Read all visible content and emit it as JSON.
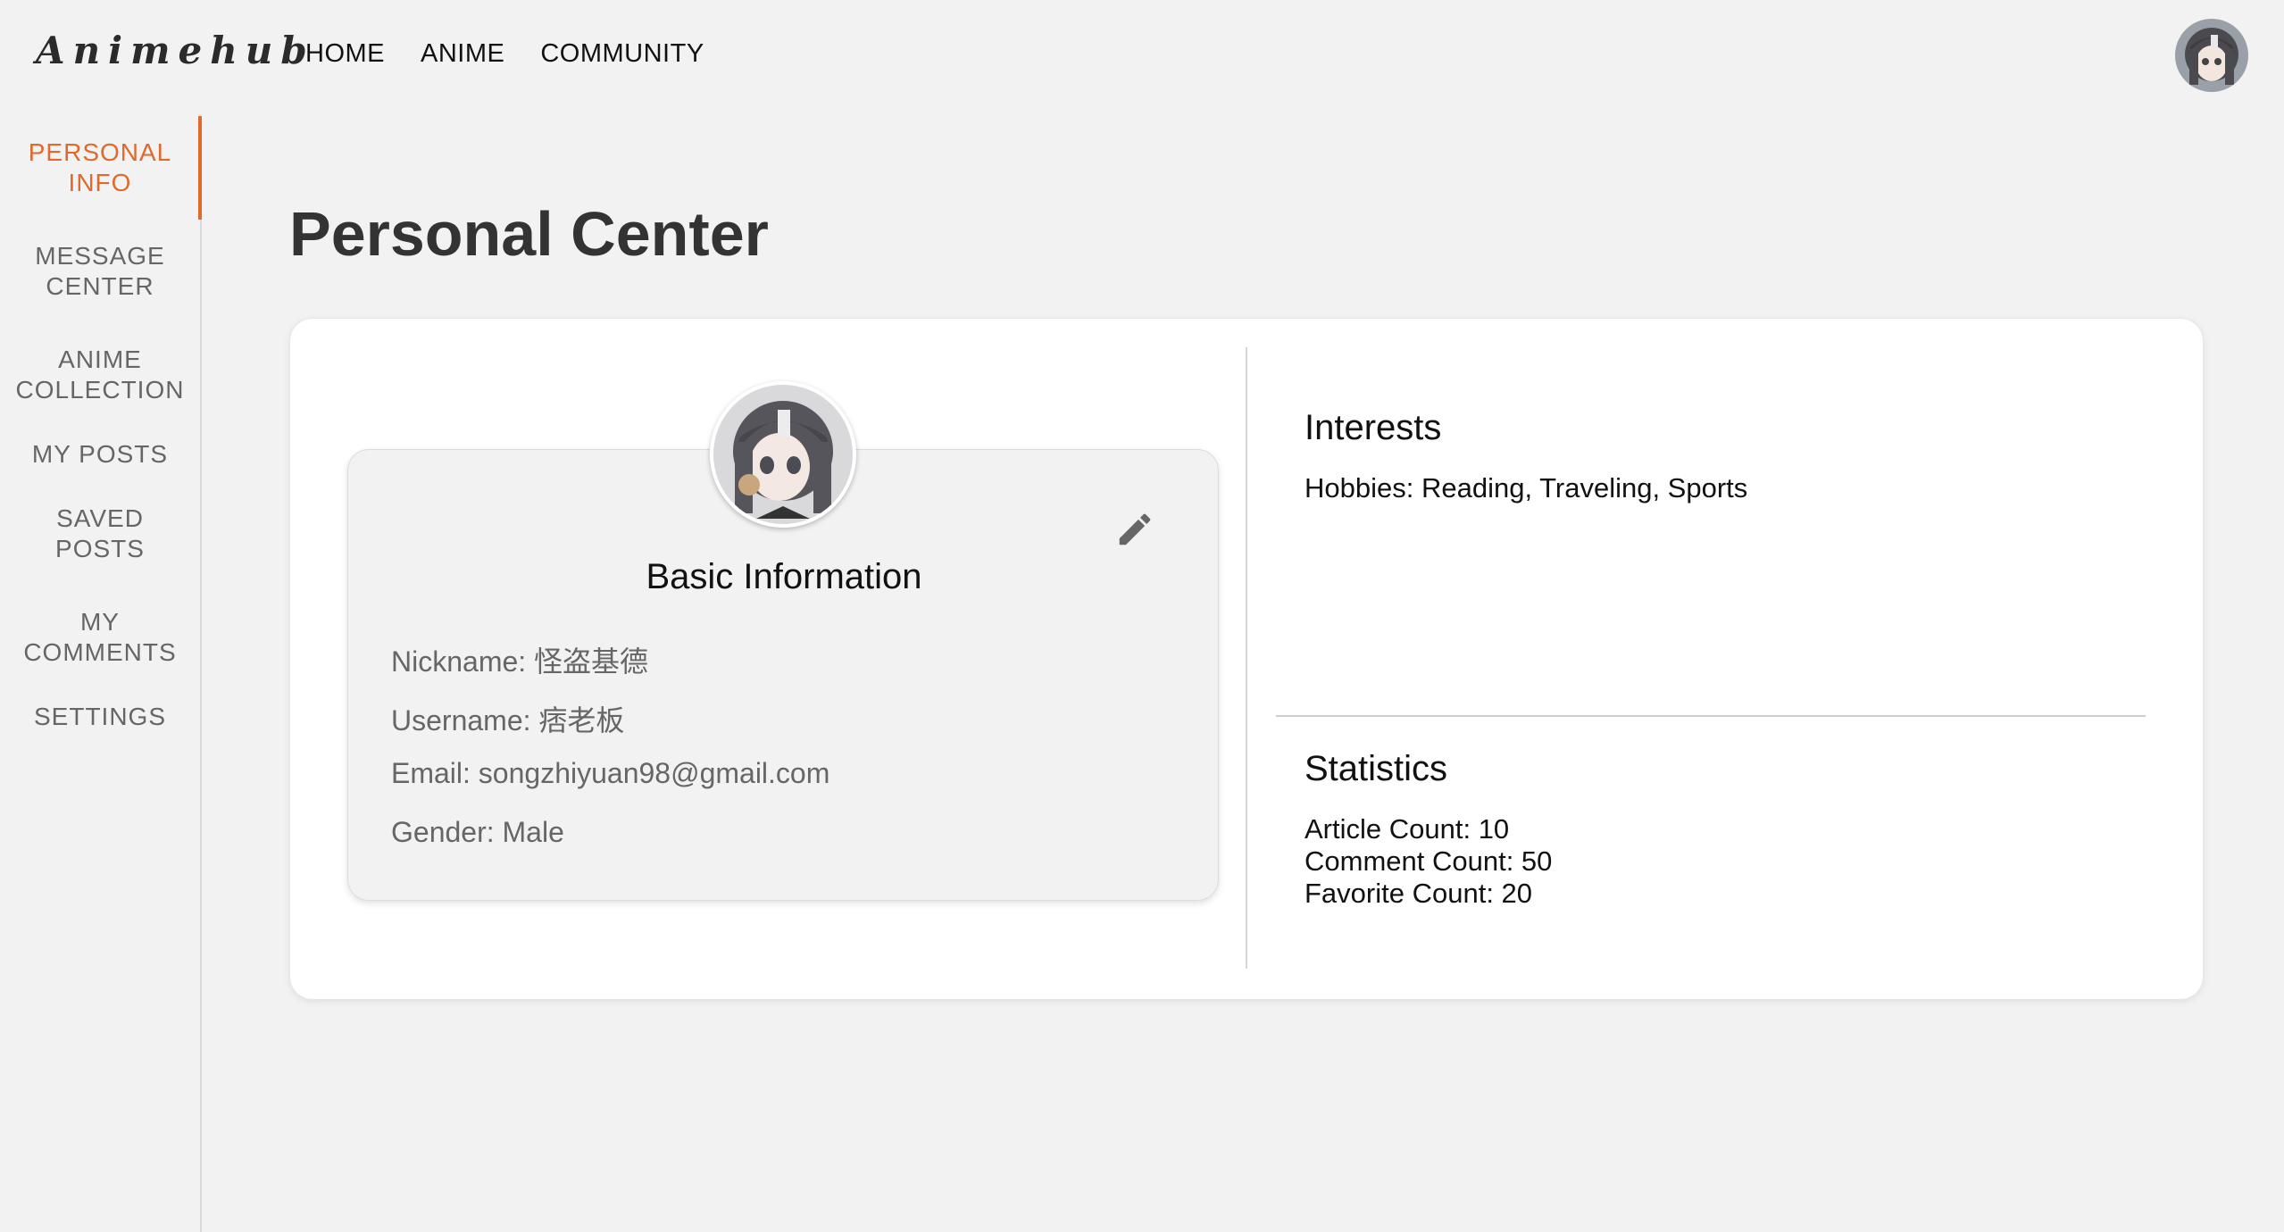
{
  "header": {
    "logo": "Animehub",
    "nav": [
      "HOME",
      "ANIME",
      "COMMUNITY"
    ],
    "avatar_icon": "user-avatar"
  },
  "sidebar": {
    "items": [
      {
        "label": "PERSONAL\nINFO",
        "active": true
      },
      {
        "label": "MESSAGE\nCENTER",
        "active": false
      },
      {
        "label": "ANIME\nCOLLECTION",
        "active": false
      },
      {
        "label": "MY POSTS",
        "active": false
      },
      {
        "label": "SAVED\nPOSTS",
        "active": false
      },
      {
        "label": "MY\nCOMMENTS",
        "active": false
      },
      {
        "label": "SETTINGS",
        "active": false
      }
    ],
    "active_color": "#e06a2c"
  },
  "main": {
    "title": "Personal Center",
    "basic_info": {
      "title": "Basic Information",
      "edit_icon": "pencil-icon",
      "nickname": "Nickname: 怪盗基德",
      "username": "Username: 痞老板",
      "email": "Email: songzhiyuan98@gmail.com",
      "gender": "Gender: Male"
    },
    "interests": {
      "title": "Interests",
      "hobbies": "Hobbies: Reading, Traveling, Sports"
    },
    "statistics": {
      "title": "Statistics",
      "article_count": "Article Count: 10",
      "comment_count": "Comment Count: 50",
      "favorite_count": "Favorite Count: 20"
    }
  }
}
